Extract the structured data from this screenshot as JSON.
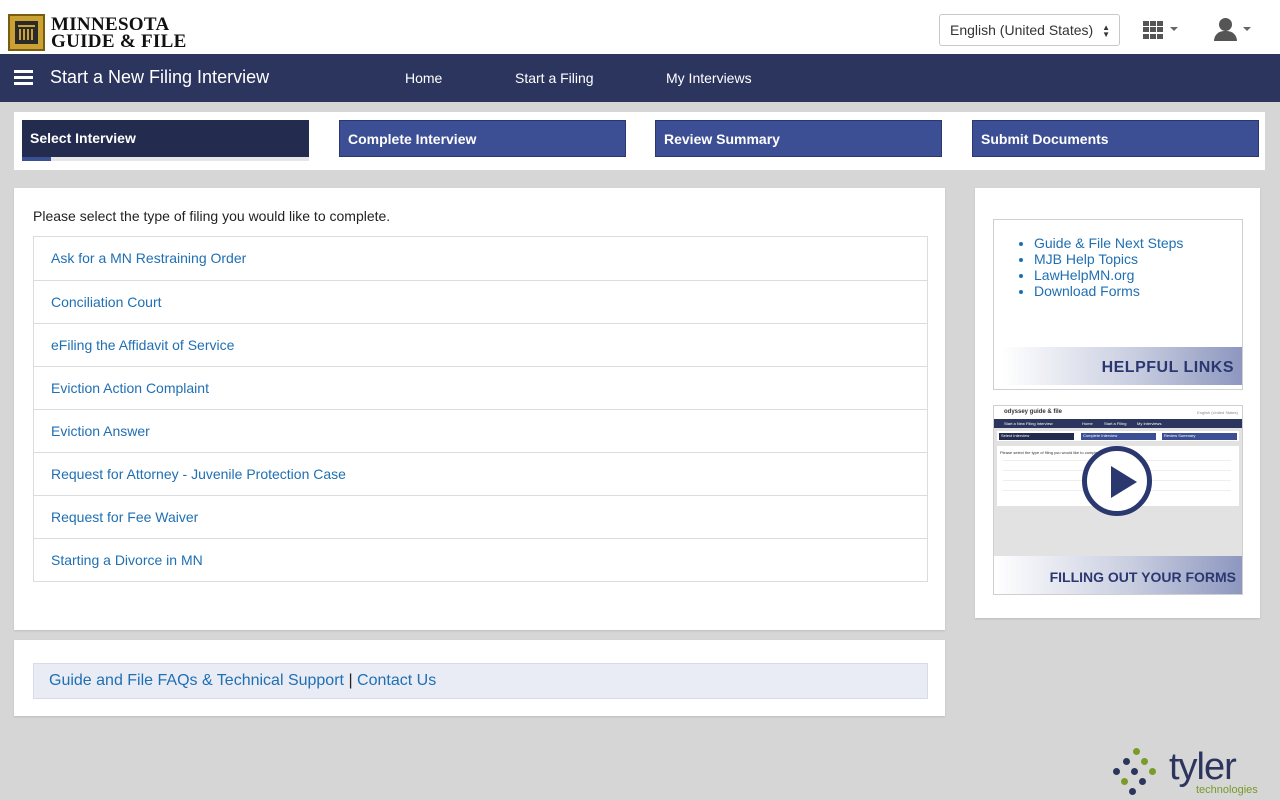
{
  "header": {
    "logo_line1": "MINNESOTA",
    "logo_line2": "GUIDE & FILE",
    "language": "English (United States)"
  },
  "nav": {
    "title": "Start a New Filing Interview",
    "links": [
      "Home",
      "Start a Filing",
      "My Interviews"
    ]
  },
  "steps": [
    {
      "label": "Select Interview",
      "state": "active"
    },
    {
      "label": "Complete Interview",
      "state": "inactive"
    },
    {
      "label": "Review Summary",
      "state": "inactive"
    },
    {
      "label": "Submit Documents",
      "state": "inactive"
    }
  ],
  "main": {
    "intro": "Please select the type of filing you would like to complete.",
    "interviews": [
      "Ask for a MN Restraining Order",
      "Conciliation Court",
      "eFiling the Affidavit of Service",
      "Eviction Action Complaint",
      "Eviction Answer",
      "Request for Attorney - Juvenile Protection Case",
      "Request for Fee Waiver",
      "Starting a Divorce in MN"
    ]
  },
  "footer": {
    "faq_link": "Guide and File FAQs & Technical Support",
    "separator": "|",
    "contact_link": "Contact Us"
  },
  "side": {
    "helpful_links": [
      "Guide & File Next Steps",
      "MJB Help Topics",
      "LawHelpMN.org",
      "Download Forms"
    ],
    "helpful_links_title": "HELPFUL LINKS",
    "video_title": "FILLING OUT YOUR FORMS",
    "video_thumb": {
      "logo": "odyssey guide & file",
      "lang": "English (United States)",
      "nav_title": "Start a New Filing Interview",
      "nav_links": [
        "Home",
        "Start a Filing",
        "My Interviews"
      ],
      "steps": [
        "Select Interview",
        "Complete Interview",
        "Review Summary"
      ],
      "intro": "Please select the type of filing you would like to complete."
    }
  },
  "brand": {
    "word": "tyler",
    "sub": "technologies"
  },
  "colors": {
    "navbar": "#2b355e",
    "step_active": "#232b4e",
    "step_inactive": "#3d4f94",
    "link": "#1f6fb3"
  },
  "icons": [
    "hamburger-icon",
    "apps-grid-icon",
    "user-icon",
    "play-icon",
    "select-caret-icon"
  ]
}
